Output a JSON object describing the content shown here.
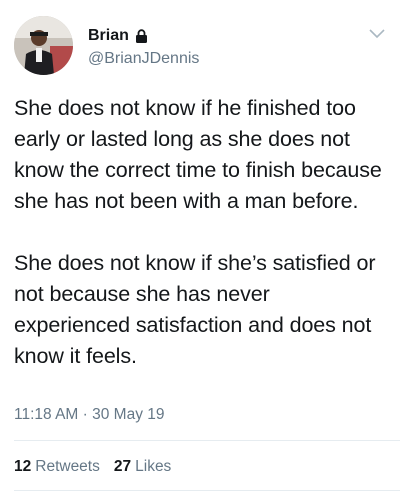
{
  "author": {
    "display_name": "Brian",
    "handle": "@BrianJDennis",
    "protected_icon": "lock-icon",
    "avatar_icon": "avatar"
  },
  "menu_icon": "chevron-down-icon",
  "tweet": {
    "paragraphs": [
      "She does not know if he finished too early or lasted long as she does not know the correct time to finish because she has not been with a man before.",
      "She does not know if she’s satisfied or not because she has never experienced satisfaction and does not know it feels."
    ],
    "timestamp": "11:18 AM · 30 May 19"
  },
  "stats": {
    "retweets_count": "12",
    "retweets_label": "Retweets",
    "likes_count": "27",
    "likes_label": "Likes"
  },
  "colors": {
    "text": "#14171a",
    "secondary": "#657786",
    "divider": "#e6ecf0"
  }
}
